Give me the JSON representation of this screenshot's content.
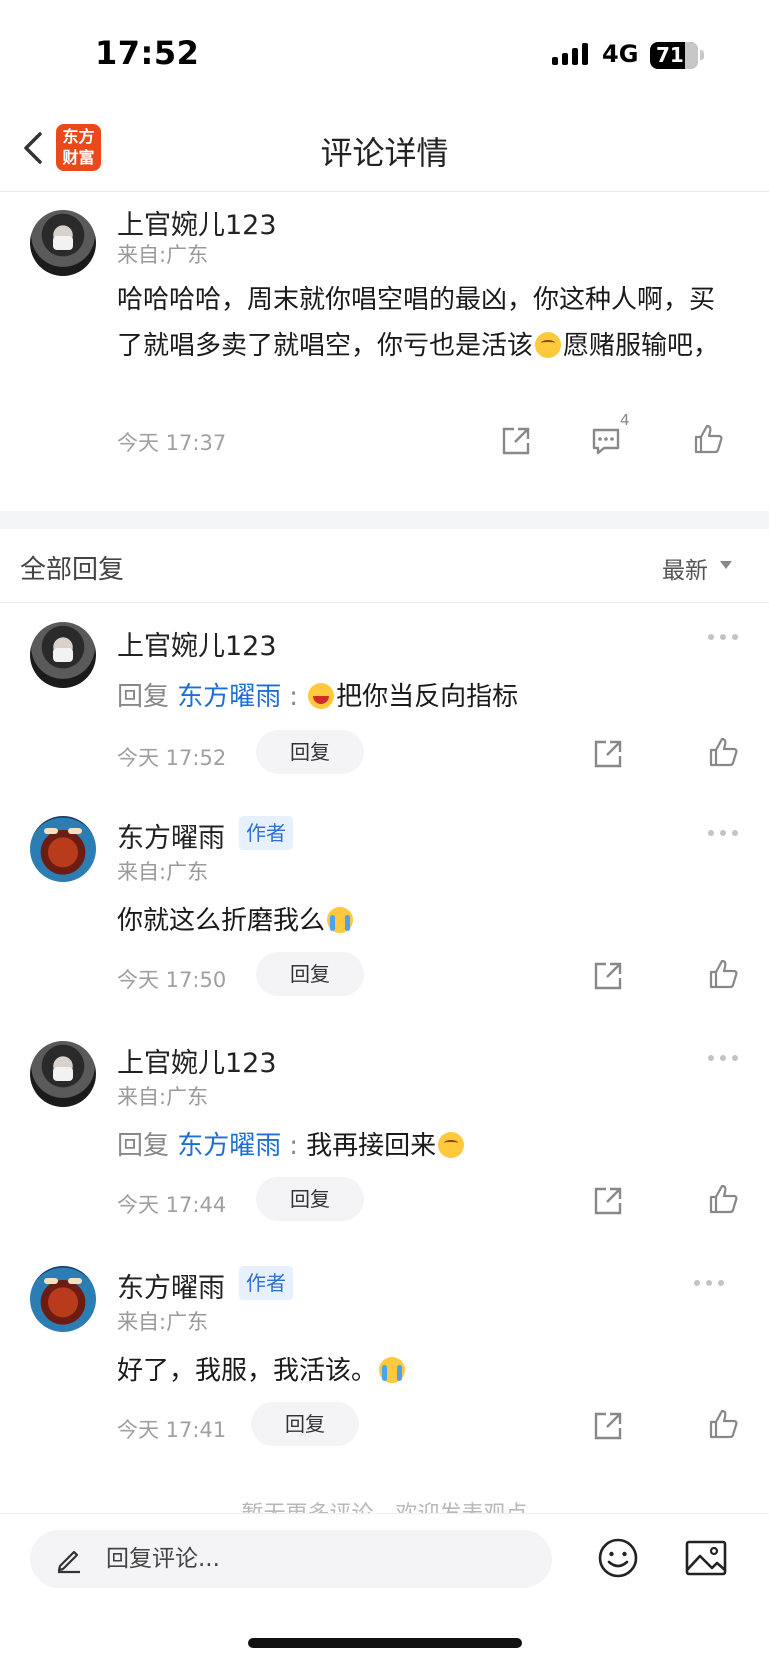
{
  "status_bar": {
    "time": "17:52",
    "network": "4G",
    "battery": "71"
  },
  "nav": {
    "title": "评论详情",
    "logo_line1": "东方",
    "logo_line2": "财富"
  },
  "main_comment": {
    "author": "上官婉儿123",
    "location": "来自:广东",
    "text_before": "哈哈哈哈，周末就你唱空唱的最凶，你这种人啊，买了就唱多卖了就唱空，你亏也是活该",
    "text_after": "愿赌服输吧，",
    "time": "今天 17:37",
    "reply_count": "4"
  },
  "section": {
    "title": "全部回复",
    "sort": "最新"
  },
  "replies": [
    {
      "author": "上官婉儿123",
      "prefix": "回复",
      "target": "东方曜雨",
      "colon": ":",
      "text": "把你当反向指标",
      "time": "今天 17:52",
      "reply_label": "回复"
    },
    {
      "author": "东方曜雨",
      "badge": "作者",
      "location": "来自:广东",
      "text": "你就这么折磨我么",
      "time": "今天 17:50",
      "reply_label": "回复"
    },
    {
      "author": "上官婉儿123",
      "location": "来自:广东",
      "prefix": "回复",
      "target": "东方曜雨",
      "colon": ":",
      "text": "我再接回来",
      "time": "今天 17:44",
      "reply_label": "回复"
    },
    {
      "author": "东方曜雨",
      "badge": "作者",
      "location": "来自:广东",
      "text": "好了，我服，我活该。",
      "time": "今天 17:41",
      "reply_label": "回复"
    }
  ],
  "footer_note": "暂无更多评论，欢迎发表观点",
  "bottom_bar": {
    "placeholder": "回复评论..."
  },
  "icons": [
    "back-arrow-icon",
    "share-icon",
    "comment-icon",
    "like-icon",
    "more-icon",
    "pen-icon",
    "emoji-icon",
    "image-icon"
  ],
  "colors": {
    "accent": "#1f6ed4",
    "logo": "#ea4a1b",
    "author_badge_bg": "#e7f1fd"
  }
}
